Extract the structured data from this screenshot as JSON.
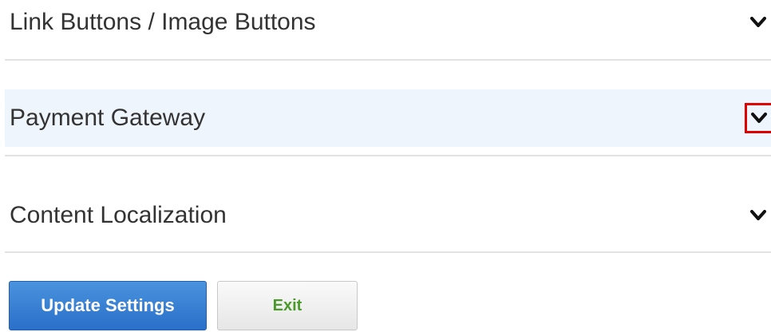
{
  "sections": [
    {
      "title": "Link Buttons / Image Buttons",
      "icon": "chevron-down-icon",
      "highlighted": false
    },
    {
      "title": "Payment Gateway",
      "icon": "chevron-down-icon",
      "highlighted": true
    },
    {
      "title": "Content Localization",
      "icon": "chevron-down-icon",
      "highlighted": false
    }
  ],
  "actions": {
    "update_label": "Update Settings",
    "exit_label": "Exit"
  },
  "colors": {
    "primary_button": "#2a6fc9",
    "exit_text": "#4a9a2a",
    "highlight_row": "#eef5fc",
    "highlight_box": "#e00000"
  }
}
